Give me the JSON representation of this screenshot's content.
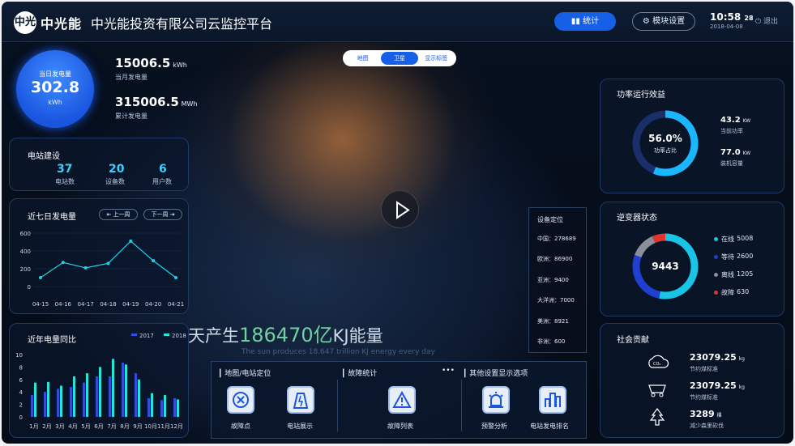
{
  "header": {
    "logo_text": "中光",
    "brand": "中光能",
    "title": "中光能投资有限公司云监控平台",
    "stats_label": "统计",
    "module_label": "模块设置",
    "time_main": "10:58",
    "time_sec": "28",
    "date": "2018-04-08",
    "logout_label": "退出"
  },
  "today": {
    "label": "当日发电量",
    "value": "302.8",
    "unit": "kWh"
  },
  "month": {
    "value": "15006.5",
    "unit": "kWh",
    "label": "当月发电量"
  },
  "total": {
    "value": "315006.5",
    "unit": "MWh",
    "label": "累计发电量"
  },
  "build": {
    "title": "电站建设",
    "items": [
      {
        "value": "37",
        "label": "电站数"
      },
      {
        "value": "20",
        "label": "设备数"
      },
      {
        "value": "6",
        "label": "用户数"
      }
    ]
  },
  "week": {
    "title": "近七日发电量",
    "prev_label": "上一周",
    "next_label": "下一周"
  },
  "yearcmp": {
    "title": "近年电量同比"
  },
  "map_tabs": [
    "地图",
    "卫星",
    "显示标签"
  ],
  "slogan": {
    "pre": "天产生",
    "num": "186470亿",
    "post": "KJ能量",
    "en": "The sun produces 18.647 trillion KJ energy every day"
  },
  "location": {
    "title": "设备定位",
    "rows": [
      "中国：278689",
      "欧洲：86900",
      "亚洲：9400",
      "大洋洲：7000",
      "美洲：8921",
      "非洲：600"
    ]
  },
  "bottom": {
    "sec1": "地图/电站定位",
    "sec2": "故障统计",
    "sec3": "其他设置显示选项",
    "more": "•••",
    "items": [
      {
        "label": "故障点",
        "icon": "fault-point-icon"
      },
      {
        "label": "电站展示",
        "icon": "station-icon"
      },
      {
        "label": "故障列表",
        "icon": "warning-icon"
      },
      {
        "label": "预警分析",
        "icon": "alarm-icon"
      },
      {
        "label": "电站发电排名",
        "icon": "ranking-icon"
      }
    ]
  },
  "power": {
    "title": "功率运行效益",
    "percent": "56.0%",
    "percent_label": "功率占比",
    "ratio": 0.56,
    "v1": "43.2",
    "u1": "KW",
    "l1": "当前功率",
    "v2": "77.0",
    "u2": "KW",
    "l2": "装机容量"
  },
  "inverter": {
    "title": "逆变器状态",
    "total": "9443",
    "items": [
      {
        "label": "在线",
        "value": "5008",
        "color": "#19c4e6"
      },
      {
        "label": "等待",
        "value": "2600",
        "color": "#1f3fd1"
      },
      {
        "label": "离线",
        "value": "1205",
        "color": "#8a8f99"
      },
      {
        "label": "故障",
        "value": "630",
        "color": "#e0352f"
      }
    ]
  },
  "social": {
    "title": "社会贡献",
    "items": [
      {
        "value": "23079.25",
        "unit": "kg",
        "label": "节约煤标准",
        "icon": "co2-icon"
      },
      {
        "value": "23079.25",
        "unit": "kg",
        "label": "节约煤标准",
        "icon": "coal-cart-icon"
      },
      {
        "value": "3289",
        "unit": "棵",
        "label": "减少森里砍伐",
        "icon": "tree-icon"
      }
    ]
  },
  "chart_data": [
    {
      "type": "line",
      "title": "近七日发电量",
      "categories": [
        "04-15",
        "04-16",
        "04-17",
        "04-18",
        "04-19",
        "04-20",
        "04-21"
      ],
      "values": [
        100,
        270,
        210,
        260,
        510,
        290,
        100
      ],
      "ylim": [
        0,
        600
      ],
      "yticks": [
        0,
        200,
        400,
        600
      ]
    },
    {
      "type": "bar",
      "title": "近年电量同比",
      "categories": [
        "1月",
        "2月",
        "3月",
        "4月",
        "5月",
        "6月",
        "7月",
        "8月",
        "9月",
        "10月",
        "11月",
        "12月"
      ],
      "series": [
        {
          "name": "2017",
          "values": [
            3.5,
            4.0,
            4.5,
            4.8,
            5.5,
            6.5,
            6.5,
            8.7,
            7.0,
            3.0,
            2.7,
            3.0
          ],
          "color": "#2f4de0"
        },
        {
          "name": "2018",
          "values": [
            5.5,
            5.6,
            5.0,
            6.5,
            7.0,
            8.0,
            9.3,
            8.4,
            6.0,
            3.8,
            3.5,
            2.8
          ],
          "color": "#21e6d9"
        }
      ],
      "ylim": [
        0,
        10
      ],
      "yticks": [
        0,
        2,
        4,
        6,
        8,
        10
      ]
    }
  ]
}
